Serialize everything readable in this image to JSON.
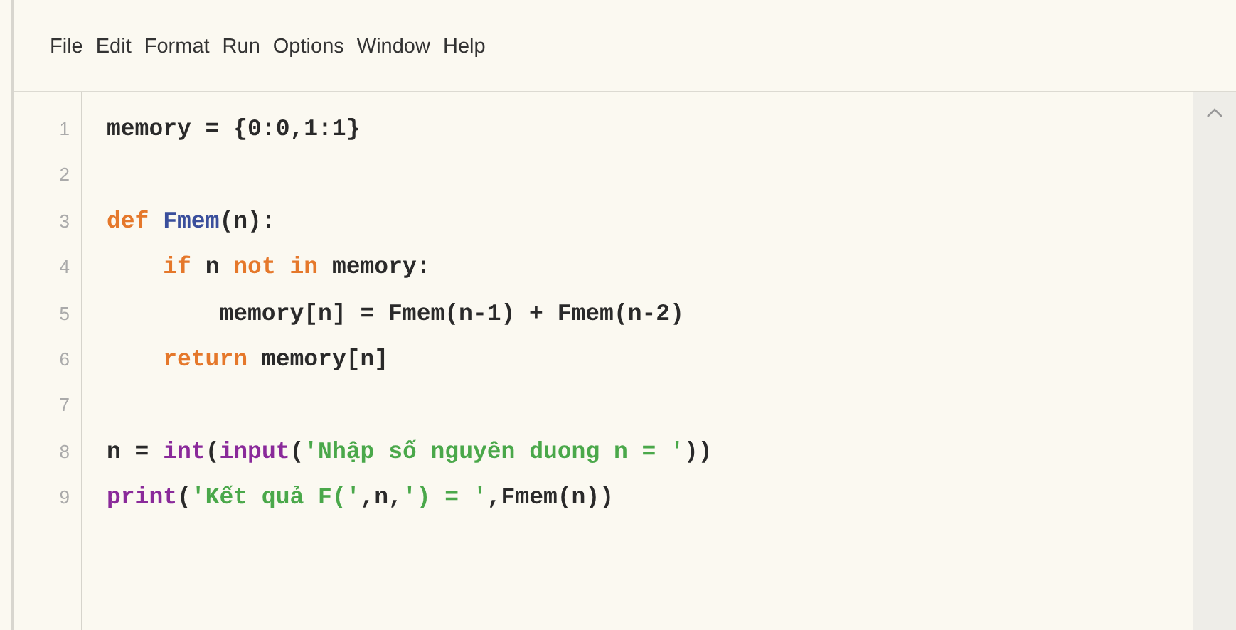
{
  "menu": [
    "File",
    "Edit",
    "Format",
    "Run",
    "Options",
    "Window",
    "Help"
  ],
  "editor": {
    "lines": [
      {
        "number": "1",
        "tokens": [
          {
            "kind": "plain",
            "text": "memory = {0:0,1:1}"
          }
        ]
      },
      {
        "number": "2"
      },
      {
        "number": "3",
        "tokens": [
          {
            "kind": "keyword",
            "text": "def "
          },
          {
            "kind": "definition",
            "text": "Fmem"
          },
          {
            "kind": "plain",
            "text": "(n):"
          }
        ]
      },
      {
        "number": "4",
        "tokens": [
          {
            "kind": "keyword",
            "text": "    if"
          },
          {
            "kind": "plain",
            "text": " n "
          },
          {
            "kind": "keyword",
            "text": "not in"
          },
          {
            "kind": "plain",
            "text": " memory:"
          }
        ]
      },
      {
        "number": "5",
        "tokens": [
          {
            "kind": "plain",
            "text": "        memory[n] = Fmem(n-1) + Fmem(n-2)"
          }
        ]
      },
      {
        "number": "6",
        "tokens": [
          {
            "kind": "keyword",
            "text": "    return"
          },
          {
            "kind": "plain",
            "text": " memory[n]"
          }
        ]
      },
      {
        "number": "7"
      },
      {
        "number": "8",
        "tokens": [
          {
            "kind": "plain",
            "text": "n = "
          },
          {
            "kind": "builtin",
            "text": "int"
          },
          {
            "kind": "plain",
            "text": "("
          },
          {
            "kind": "builtin",
            "text": "input"
          },
          {
            "kind": "plain",
            "text": "("
          },
          {
            "kind": "string",
            "text": "'Nhập số nguyên duong n = '"
          },
          {
            "kind": "plain",
            "text": "))"
          }
        ]
      },
      {
        "number": "9",
        "tokens": [
          {
            "kind": "builtin",
            "text": "print"
          },
          {
            "kind": "plain",
            "text": "("
          },
          {
            "kind": "string",
            "text": "'Kết quả F('"
          },
          {
            "kind": "plain",
            "text": ",n,"
          },
          {
            "kind": "string",
            "text": "') = '"
          },
          {
            "kind": "plain",
            "text": ",Fmem(n))"
          }
        ]
      }
    ]
  }
}
